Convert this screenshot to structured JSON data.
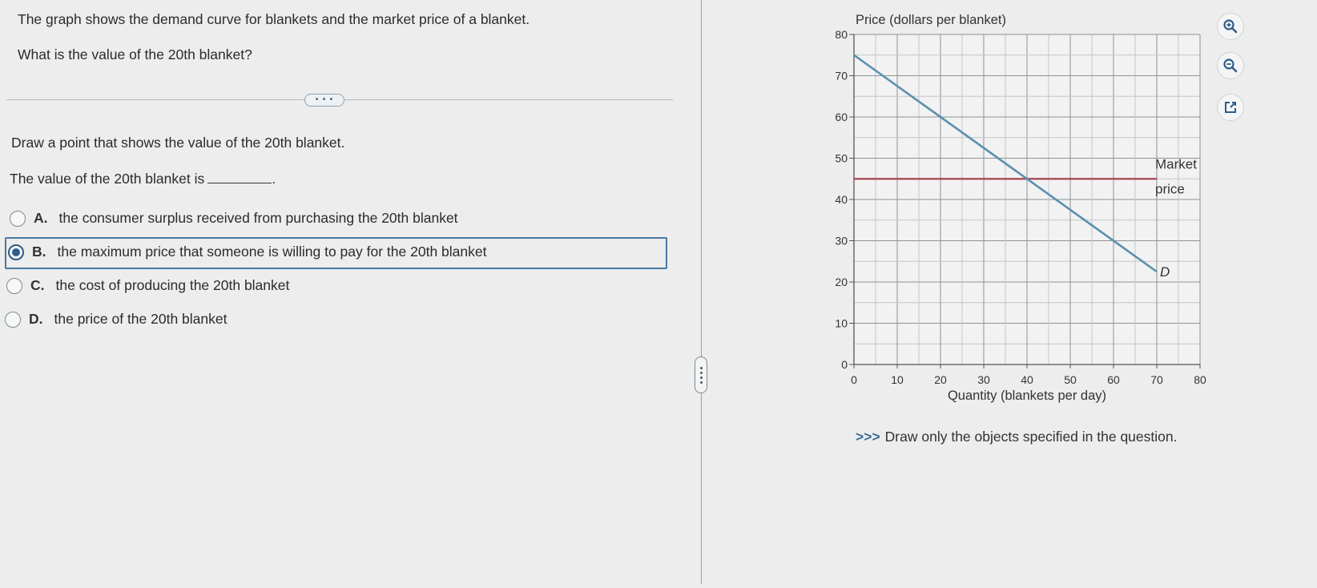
{
  "question": {
    "line1": "The graph shows the demand curve for blankets and the market price of a blanket.",
    "line2": "What is the value of the 20th blanket?",
    "more_label": "• • •",
    "instruction": "Draw a point that shows the value of the 20th blanket.",
    "blank_prefix": "The value of the 20th blanket is",
    "blank_suffix": "."
  },
  "options": [
    {
      "letter": "A.",
      "text": "the consumer surplus received from purchasing the 20th blanket",
      "selected": false
    },
    {
      "letter": "B.",
      "text": "the maximum price that someone is willing to pay for the 20th blanket",
      "selected": true
    },
    {
      "letter": "C.",
      "text": "the cost of producing the 20th blanket",
      "selected": false
    },
    {
      "letter": "D.",
      "text": "the price of the 20th blanket",
      "selected": false
    }
  ],
  "graph": {
    "y_axis_title": "Price (dollars per blanket)",
    "x_axis_title": "Quantity (blankets per day)",
    "market_label_1": "Market",
    "market_label_2": "price",
    "demand_label": "D",
    "note_arrows": ">>>",
    "note_text": "Draw only the objects specified in the question."
  },
  "tools": [
    "zoom-in-icon",
    "zoom-out-icon",
    "external-link-icon"
  ],
  "colors": {
    "demand": "#5b8fae",
    "market_price": "#a8434f",
    "accent": "#2e5d8a"
  },
  "chart_data": {
    "type": "line",
    "title": "",
    "xlabel": "Quantity (blankets per day)",
    "ylabel": "Price (dollars per blanket)",
    "xlim": [
      0,
      80
    ],
    "ylim": [
      0,
      80
    ],
    "x_ticks": [
      0,
      10,
      20,
      30,
      40,
      50,
      60,
      70,
      80
    ],
    "y_ticks": [
      0,
      10,
      20,
      30,
      40,
      50,
      60,
      70,
      80
    ],
    "grid": true,
    "series": [
      {
        "name": "D",
        "x": [
          0,
          70
        ],
        "y": [
          75,
          22.5
        ]
      },
      {
        "name": "Market price",
        "x": [
          0,
          70
        ],
        "y": [
          45,
          45
        ]
      }
    ]
  }
}
